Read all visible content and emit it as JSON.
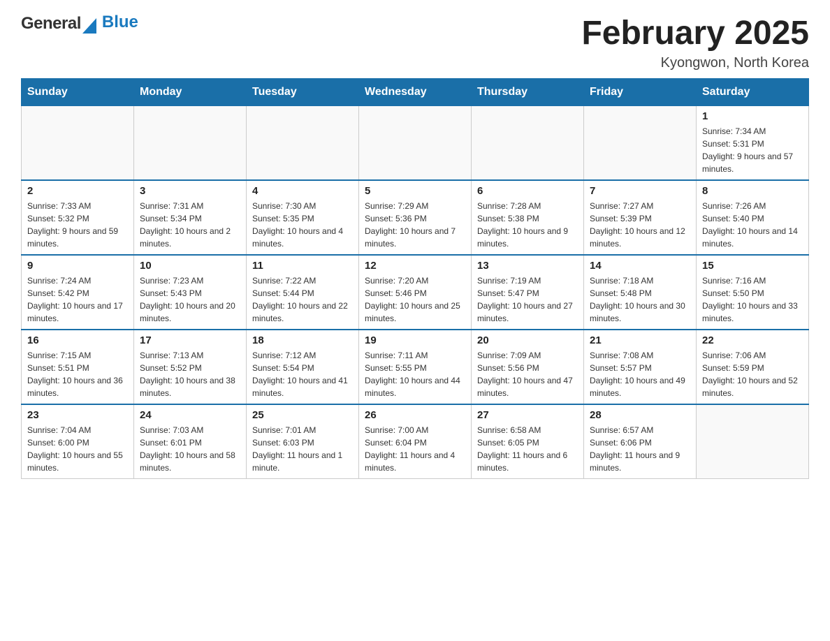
{
  "logo": {
    "text_general": "General",
    "text_blue": "Blue"
  },
  "title": "February 2025",
  "subtitle": "Kyongwon, North Korea",
  "weekdays": [
    "Sunday",
    "Monday",
    "Tuesday",
    "Wednesday",
    "Thursday",
    "Friday",
    "Saturday"
  ],
  "weeks": [
    [
      {
        "day": "",
        "info": ""
      },
      {
        "day": "",
        "info": ""
      },
      {
        "day": "",
        "info": ""
      },
      {
        "day": "",
        "info": ""
      },
      {
        "day": "",
        "info": ""
      },
      {
        "day": "",
        "info": ""
      },
      {
        "day": "1",
        "info": "Sunrise: 7:34 AM\nSunset: 5:31 PM\nDaylight: 9 hours and 57 minutes."
      }
    ],
    [
      {
        "day": "2",
        "info": "Sunrise: 7:33 AM\nSunset: 5:32 PM\nDaylight: 9 hours and 59 minutes."
      },
      {
        "day": "3",
        "info": "Sunrise: 7:31 AM\nSunset: 5:34 PM\nDaylight: 10 hours and 2 minutes."
      },
      {
        "day": "4",
        "info": "Sunrise: 7:30 AM\nSunset: 5:35 PM\nDaylight: 10 hours and 4 minutes."
      },
      {
        "day": "5",
        "info": "Sunrise: 7:29 AM\nSunset: 5:36 PM\nDaylight: 10 hours and 7 minutes."
      },
      {
        "day": "6",
        "info": "Sunrise: 7:28 AM\nSunset: 5:38 PM\nDaylight: 10 hours and 9 minutes."
      },
      {
        "day": "7",
        "info": "Sunrise: 7:27 AM\nSunset: 5:39 PM\nDaylight: 10 hours and 12 minutes."
      },
      {
        "day": "8",
        "info": "Sunrise: 7:26 AM\nSunset: 5:40 PM\nDaylight: 10 hours and 14 minutes."
      }
    ],
    [
      {
        "day": "9",
        "info": "Sunrise: 7:24 AM\nSunset: 5:42 PM\nDaylight: 10 hours and 17 minutes."
      },
      {
        "day": "10",
        "info": "Sunrise: 7:23 AM\nSunset: 5:43 PM\nDaylight: 10 hours and 20 minutes."
      },
      {
        "day": "11",
        "info": "Sunrise: 7:22 AM\nSunset: 5:44 PM\nDaylight: 10 hours and 22 minutes."
      },
      {
        "day": "12",
        "info": "Sunrise: 7:20 AM\nSunset: 5:46 PM\nDaylight: 10 hours and 25 minutes."
      },
      {
        "day": "13",
        "info": "Sunrise: 7:19 AM\nSunset: 5:47 PM\nDaylight: 10 hours and 27 minutes."
      },
      {
        "day": "14",
        "info": "Sunrise: 7:18 AM\nSunset: 5:48 PM\nDaylight: 10 hours and 30 minutes."
      },
      {
        "day": "15",
        "info": "Sunrise: 7:16 AM\nSunset: 5:50 PM\nDaylight: 10 hours and 33 minutes."
      }
    ],
    [
      {
        "day": "16",
        "info": "Sunrise: 7:15 AM\nSunset: 5:51 PM\nDaylight: 10 hours and 36 minutes."
      },
      {
        "day": "17",
        "info": "Sunrise: 7:13 AM\nSunset: 5:52 PM\nDaylight: 10 hours and 38 minutes."
      },
      {
        "day": "18",
        "info": "Sunrise: 7:12 AM\nSunset: 5:54 PM\nDaylight: 10 hours and 41 minutes."
      },
      {
        "day": "19",
        "info": "Sunrise: 7:11 AM\nSunset: 5:55 PM\nDaylight: 10 hours and 44 minutes."
      },
      {
        "day": "20",
        "info": "Sunrise: 7:09 AM\nSunset: 5:56 PM\nDaylight: 10 hours and 47 minutes."
      },
      {
        "day": "21",
        "info": "Sunrise: 7:08 AM\nSunset: 5:57 PM\nDaylight: 10 hours and 49 minutes."
      },
      {
        "day": "22",
        "info": "Sunrise: 7:06 AM\nSunset: 5:59 PM\nDaylight: 10 hours and 52 minutes."
      }
    ],
    [
      {
        "day": "23",
        "info": "Sunrise: 7:04 AM\nSunset: 6:00 PM\nDaylight: 10 hours and 55 minutes."
      },
      {
        "day": "24",
        "info": "Sunrise: 7:03 AM\nSunset: 6:01 PM\nDaylight: 10 hours and 58 minutes."
      },
      {
        "day": "25",
        "info": "Sunrise: 7:01 AM\nSunset: 6:03 PM\nDaylight: 11 hours and 1 minute."
      },
      {
        "day": "26",
        "info": "Sunrise: 7:00 AM\nSunset: 6:04 PM\nDaylight: 11 hours and 4 minutes."
      },
      {
        "day": "27",
        "info": "Sunrise: 6:58 AM\nSunset: 6:05 PM\nDaylight: 11 hours and 6 minutes."
      },
      {
        "day": "28",
        "info": "Sunrise: 6:57 AM\nSunset: 6:06 PM\nDaylight: 11 hours and 9 minutes."
      },
      {
        "day": "",
        "info": ""
      }
    ]
  ]
}
